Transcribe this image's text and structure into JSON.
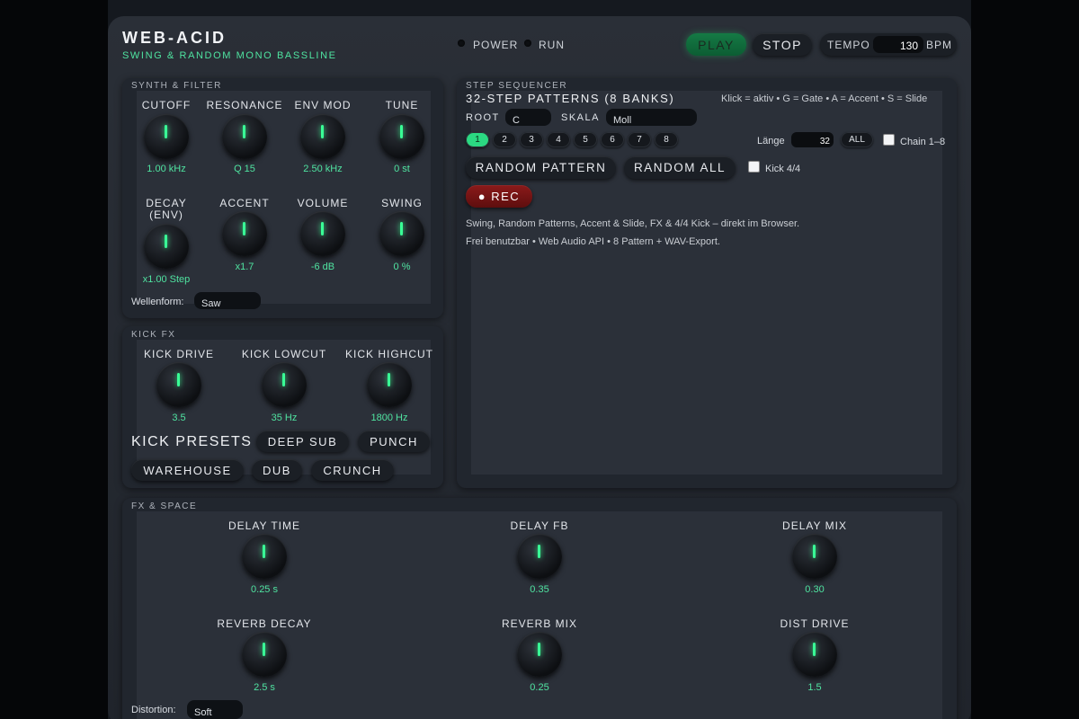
{
  "header": {
    "title": "WEB-ACID",
    "subtitle": "SWING & RANDOM MONO BASSLINE",
    "power_label": "POWER",
    "run_label": "RUN",
    "play_label": "PLAY",
    "stop_label": "STOP",
    "tempo_label": "TEMPO",
    "tempo_value": "130",
    "bpm_label": "BPM"
  },
  "synth": {
    "section_label": "SYNTH & FILTER",
    "knobs": [
      {
        "label": "CUTOFF",
        "value": "1.00 kHz"
      },
      {
        "label": "RESONANCE",
        "value": "Q 15"
      },
      {
        "label": "ENV MOD",
        "value": "2.50 kHz"
      },
      {
        "label": "TUNE",
        "value": "0 st"
      },
      {
        "label": "DECAY",
        "label2": "(ENV)",
        "value": "x1.00 Step"
      },
      {
        "label": "ACCENT",
        "value": "x1.7"
      },
      {
        "label": "VOLUME",
        "value": "-6 dB"
      },
      {
        "label": "SWING",
        "value": "0 %"
      }
    ],
    "waveform_label": "Wellenform:",
    "waveform_value": "Saw"
  },
  "kick": {
    "section_label": "KICK FX",
    "knobs": [
      {
        "label": "KICK DRIVE",
        "value": "3.5"
      },
      {
        "label": "KICK LOWCUT",
        "value": "35 Hz"
      },
      {
        "label": "KICK HIGHCUT",
        "value": "1800 Hz"
      }
    ],
    "presets_label": "KICK PRESETS",
    "presets": [
      "DEEP SUB",
      "PUNCH",
      "WAREHOUSE",
      "DUB",
      "CRUNCH"
    ]
  },
  "sequencer": {
    "section_label": "STEP SEQUENCER",
    "heading": "32-STEP PATTERNS (8 BANKS)",
    "hint": "Klick = aktiv • G = Gate • A = Accent • S = Slide",
    "root_label": "ROOT",
    "root_value": "C",
    "scale_label": "SKALA",
    "scale_value": "Moll",
    "banks": [
      "1",
      "2",
      "3",
      "4",
      "5",
      "6",
      "7",
      "8"
    ],
    "active_bank": "1",
    "length_label": "Länge",
    "length_value": "32",
    "all_label": "ALL",
    "chain_label": "Chain 1–8",
    "random_pattern_label": "RANDOM PATTERN",
    "random_all_label": "RANDOM ALL",
    "kick44_label": "Kick 4/4",
    "rec_label": "● REC",
    "info_line1": "Swing, Random Patterns, Accent & Slide, FX & 4/4 Kick – direkt im Browser.",
    "info_line2": "Frei benutzbar • Web Audio API • 8 Pattern + WAV-Export."
  },
  "fx": {
    "section_label": "FX & SPACE",
    "knobs": [
      {
        "label": "DELAY TIME",
        "value": "0.25 s"
      },
      {
        "label": "DELAY FB",
        "value": "0.35"
      },
      {
        "label": "DELAY MIX",
        "value": "0.30"
      },
      {
        "label": "REVERB DECAY",
        "value": "2.5 s"
      },
      {
        "label": "REVERB MIX",
        "value": "0.25"
      },
      {
        "label": "DIST DRIVE",
        "value": "1.5"
      }
    ],
    "distortion_label": "Distortion:",
    "distortion_value": "Soft"
  },
  "colors": {
    "accent": "#39ff96",
    "value_text": "#4fe3a0",
    "play": "#157a45",
    "rec": "#8b1a1a",
    "background": "#050608",
    "panel": "#21262e"
  }
}
